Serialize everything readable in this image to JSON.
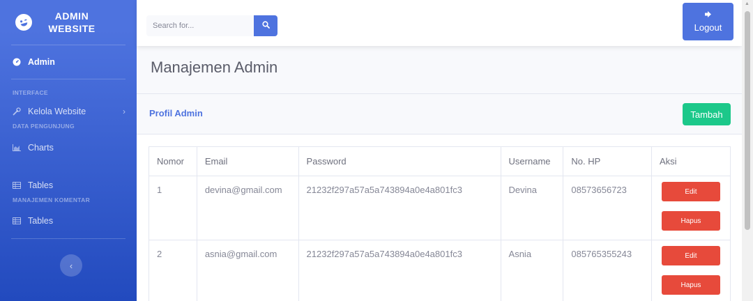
{
  "brand": {
    "line1": "ADMIN",
    "line2": "WEBSITE",
    "icon": "laugh-wink-icon"
  },
  "sidebar": {
    "admin": "Admin",
    "heading_interface": "INTERFACE",
    "kelola": "Kelola Website",
    "heading_pengunjung": "DATA PENGUNJUNG",
    "charts": "Charts",
    "tables1": "Tables",
    "heading_komentar": "MANAJEMEN KOMENTAR",
    "tables2": "Tables"
  },
  "search": {
    "placeholder": "Search for..."
  },
  "topbar": {
    "logout": "Logout"
  },
  "page": {
    "title": "Manajemen Admin"
  },
  "card": {
    "title": "Profil Admin",
    "add_label": "Tambah"
  },
  "table": {
    "headers": [
      "Nomor",
      "Email",
      "Password",
      "Username",
      "No. HP",
      "Aksi"
    ],
    "rows": [
      {
        "no": "1",
        "email": "devina@gmail.com",
        "password": "21232f297a57a5a743894a0e4a801fc3",
        "username": "Devina",
        "phone": "08573656723",
        "edit": "Edit",
        "hapus": "Hapus"
      },
      {
        "no": "2",
        "email": "asnia@gmail.com",
        "password": "21232f297a57a5a743894a0e4a801fc3",
        "username": "Asnia",
        "phone": "085765355243",
        "edit": "Edit",
        "hapus": "Hapus"
      }
    ]
  },
  "colors": {
    "primary": "#4e73df",
    "success": "#1cc88a",
    "danger": "#e74a3b"
  }
}
